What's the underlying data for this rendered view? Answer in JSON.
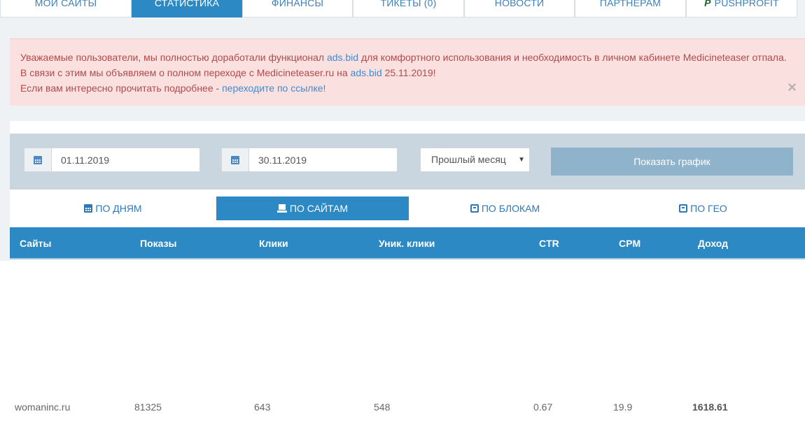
{
  "nav": {
    "tabs": [
      {
        "label": "МОИ САЙТЫ"
      },
      {
        "label": "СТАТИСТИКА"
      },
      {
        "label": "ФИНАНСЫ"
      },
      {
        "label": "ТИКЕТЫ (0)"
      },
      {
        "label": "НОВОСТИ"
      },
      {
        "label": "ПАРТНЕРАМ"
      },
      {
        "label": "PUSHPROFIT",
        "icon": "pushprofit-logo-icon"
      }
    ],
    "active": "СТАТИСТИКА"
  },
  "alert": {
    "line1_a": "Уважаемые пользователи, мы полностью доработали функционал ",
    "line1_link": "ads.bid",
    "line1_b": " для комфортного использования и необходимость в личном кабинете Medicineteaser отпала.",
    "line2_a": "В связи с этим мы объявляем о полном переходе с Medicineteaser.ru на ",
    "line2_link": "ads.bid",
    "line2_b": " 25.11.2019!",
    "line3_a": "Если вам интересно прочитать подробнее - ",
    "line3_link": "переходите по ссылке!",
    "close": "×"
  },
  "filters": {
    "date_from": "01.11.2019",
    "date_to": "30.11.2019",
    "period": "Прошлый месяц",
    "show_button": "Показать график",
    "date_icon": "calendar-icon"
  },
  "view_tabs": [
    {
      "label": "ПО ДНЯМ",
      "icon": "calendar-icon"
    },
    {
      "label": "ПО САЙТАМ",
      "icon": "site-icon"
    },
    {
      "label": "ПО БЛОКАМ",
      "icon": "block-icon"
    },
    {
      "label": "ПО ГЕО",
      "icon": "geo-icon"
    }
  ],
  "active_view": "ПО САЙТАМ",
  "table": {
    "headers": [
      "Сайты",
      "Показы",
      "Клики",
      "Уник. клики",
      "CTR",
      "CPM",
      "Доход"
    ],
    "rows": [
      {
        "site": "womaninc.ru",
        "impressions": "81325",
        "clicks": "643",
        "unique_clicks": "548",
        "ctr": "0.67",
        "cpm": "19.9",
        "income": "1618.61"
      }
    ]
  },
  "colors": {
    "primary": "#2c89c3",
    "alert_bg": "#fbe0e0",
    "alert_text": "#b14a4a",
    "link": "#3f8bd0",
    "filter_bar": "#c9d6e0",
    "button_disabled": "#8fb3cb"
  }
}
